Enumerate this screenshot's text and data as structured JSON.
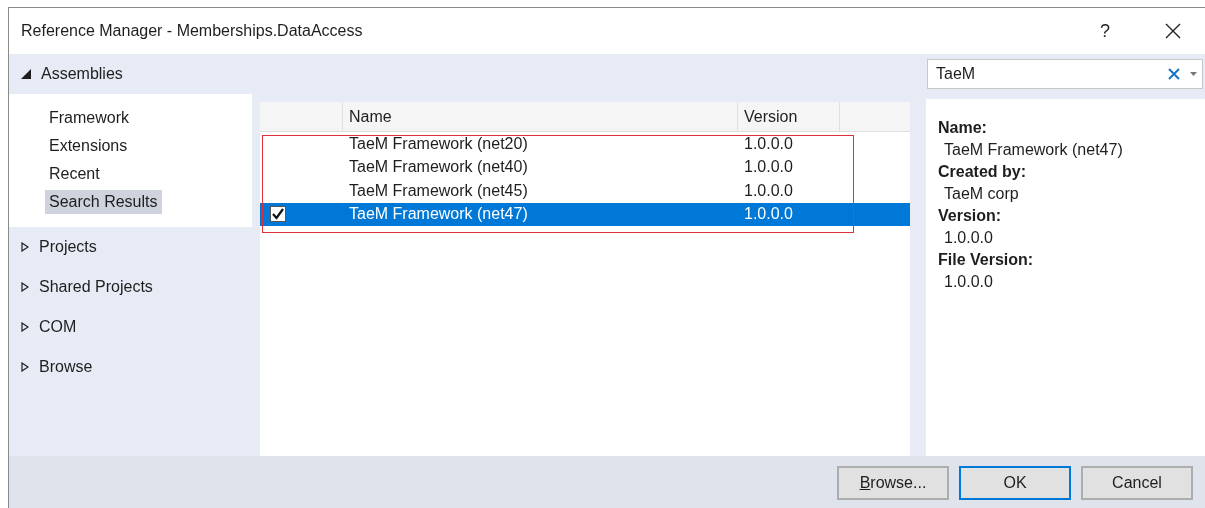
{
  "window": {
    "title": "Reference Manager - Memberships.DataAccess",
    "help": "?"
  },
  "sidebar": {
    "groups": [
      {
        "label": "Assemblies",
        "expanded": true,
        "items": [
          {
            "label": "Framework",
            "selected": false
          },
          {
            "label": "Extensions",
            "selected": false
          },
          {
            "label": "Recent",
            "selected": false
          },
          {
            "label": "Search Results",
            "selected": true
          }
        ]
      },
      {
        "label": "Projects",
        "expanded": false
      },
      {
        "label": "Shared Projects",
        "expanded": false
      },
      {
        "label": "COM",
        "expanded": false
      },
      {
        "label": "Browse",
        "expanded": false
      }
    ]
  },
  "search": {
    "value": "TaeM"
  },
  "table": {
    "columns": [
      "Name",
      "Version"
    ],
    "rows": [
      {
        "name": "TaeM Framework (net20)",
        "version": "1.0.0.0",
        "checked": false,
        "selected": false
      },
      {
        "name": "TaeM Framework (net40)",
        "version": "1.0.0.0",
        "checked": false,
        "selected": false
      },
      {
        "name": "TaeM Framework (net45)",
        "version": "1.0.0.0",
        "checked": false,
        "selected": false
      },
      {
        "name": "TaeM Framework (net47)",
        "version": "1.0.0.0",
        "checked": true,
        "selected": true
      }
    ],
    "annotation_frame": true
  },
  "details": [
    {
      "label": "Name:",
      "value": "TaeM Framework (net47)"
    },
    {
      "label": "Created by:",
      "value": "TaeM corp"
    },
    {
      "label": "Version:",
      "value": "1.0.0.0"
    },
    {
      "label": "File Version:",
      "value": "1.0.0.0"
    }
  ],
  "buttons": [
    {
      "label": "Browse...",
      "default": false
    },
    {
      "label": "OK",
      "default": true
    },
    {
      "label": "Cancel",
      "default": false
    }
  ]
}
